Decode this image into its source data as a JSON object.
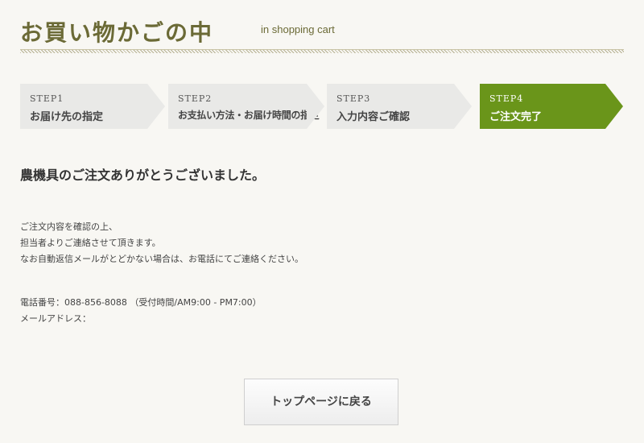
{
  "header": {
    "title": "お買い物かごの中",
    "subtitle": "in shopping cart"
  },
  "steps": [
    {
      "num": "STEP1",
      "label": "お届け先の指定",
      "active": false
    },
    {
      "num": "STEP2",
      "label": "お支払い方法・お届け時間の指定",
      "active": false
    },
    {
      "num": "STEP3",
      "label": "入力内容ご確認",
      "active": false
    },
    {
      "num": "STEP4",
      "label": "ご注文完了",
      "active": true
    }
  ],
  "main": {
    "thanks": "農機具のご注文ありがとうございました。",
    "message_lines": [
      "ご注文内容を確認の上、",
      "担当者よりご連絡させて頂きます。",
      "なお自動返信メールがとどかない場合は、お電話にてご連絡ください。"
    ],
    "phone_line": "電話番号：088-856-8088 （受付時間/AM9:00 - PM7:00）",
    "email_line": "メールアドレス："
  },
  "actions": {
    "back_to_top": "トップページに戻る"
  },
  "colors": {
    "accent_green": "#6a951a",
    "title_olive": "#6b6a36",
    "step_inactive": "#e9e9e7",
    "background": "#f8f7f3"
  }
}
